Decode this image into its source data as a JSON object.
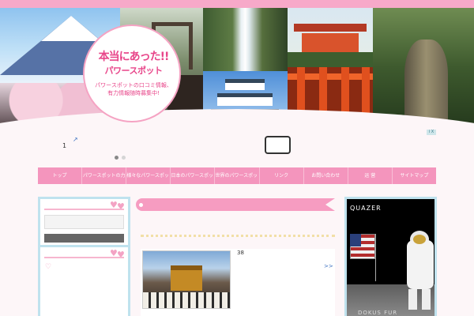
{
  "site": {
    "title_part1": "本当にあった!!",
    "title_part2": "パワースポット",
    "subtitle": "パワースポットの口コミ情報、有力情報随時募集中!"
  },
  "ad_banner": {
    "badge": "i X",
    "arrow": "↗",
    "number": "1",
    "pagination": [
      "page-1",
      "page-2"
    ]
  },
  "nav": {
    "items": [
      {
        "label": "トップ"
      },
      {
        "label": "パワースポットの力"
      },
      {
        "label": "様々なパワースポット"
      },
      {
        "label": "日本のパワースポット"
      },
      {
        "label": "世界のパワースポット"
      },
      {
        "label": "リンク"
      },
      {
        "label": "お問い合わせ"
      },
      {
        "label": "运 营"
      },
      {
        "label": "サイトマップ"
      }
    ]
  },
  "main": {
    "post": {
      "number": "38",
      "more_link": ">>"
    }
  },
  "right_ad": {
    "brand": "QUAZER",
    "brand_bottom": "DOKUS FUR"
  },
  "colors": {
    "accent_pink": "#f495bd",
    "sidebar_blue": "#bfe2ee",
    "title_pink": "#e8468a"
  },
  "icons": {
    "heart": "heart-icon",
    "arrow": "external-arrow-icon"
  }
}
